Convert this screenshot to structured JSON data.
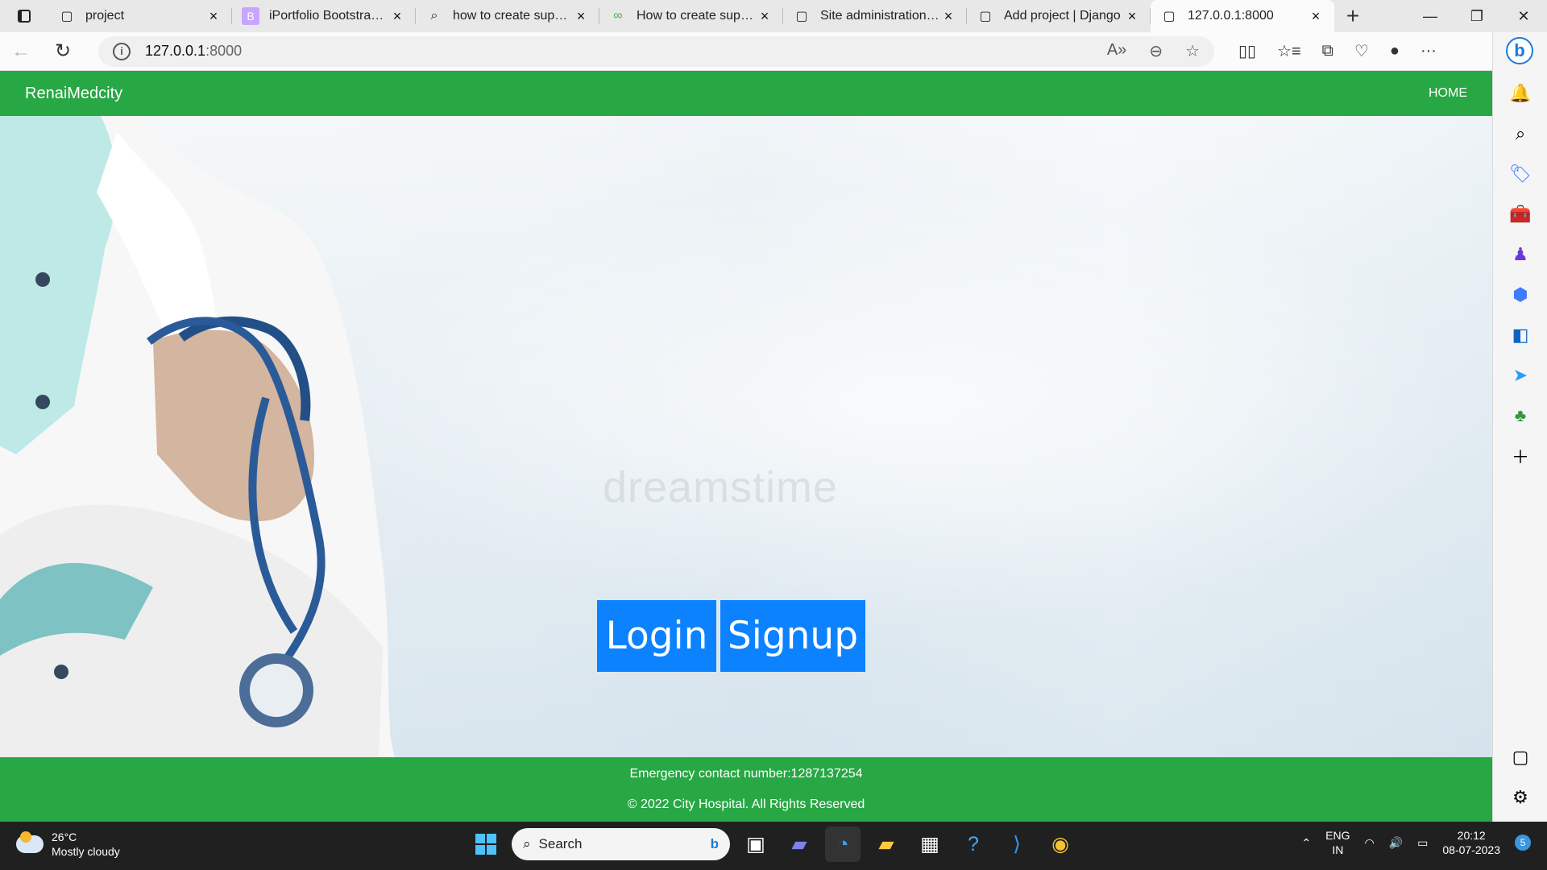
{
  "browser": {
    "tabs": [
      {
        "title": "project",
        "icon": "page-icon",
        "active": false
      },
      {
        "title": "iPortfolio Bootstrap Te",
        "icon": "bootstrap-icon",
        "active": false
      },
      {
        "title": "how to create superus",
        "icon": "search-icon",
        "active": false
      },
      {
        "title": "How to create superu",
        "icon": "link-icon",
        "active": false
      },
      {
        "title": "Site administration | D",
        "icon": "page-icon",
        "active": false
      },
      {
        "title": "Add project | Django",
        "icon": "page-icon",
        "active": false
      },
      {
        "title": "127.0.0.1:8000",
        "icon": "page-icon",
        "active": true
      }
    ],
    "address": {
      "host": "127.0.0.1",
      "port": ":8000"
    }
  },
  "site": {
    "brand": "RenaiMedcity",
    "nav_home": "HOME",
    "watermark": "dreamstime",
    "buttons": {
      "login": "Login",
      "signup": "Signup"
    },
    "footer": {
      "emergency": "Emergency contact number:1287137254",
      "copyright": "© 2022 City Hospital. All Rights Reserved"
    }
  },
  "taskbar": {
    "weather": {
      "temp": "26°C",
      "condition": "Mostly cloudy"
    },
    "search_label": "Search",
    "language": {
      "top": "ENG",
      "bottom": "IN"
    },
    "clock": {
      "time": "20:12",
      "date": "08-07-2023"
    },
    "notification_count": "5"
  }
}
